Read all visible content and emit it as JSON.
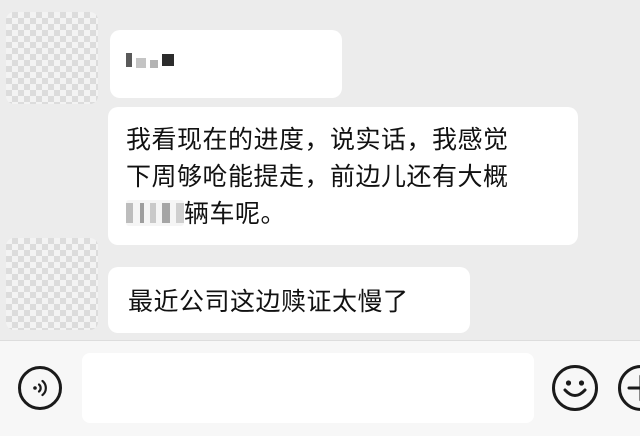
{
  "messages": [
    {
      "sender": "contact",
      "type": "name-redacted"
    },
    {
      "sender": "contact",
      "line1": "我看现在的进度，说实话，我感觉",
      "line2": "下周够呛能提走，前边儿还有大概",
      "line3_suffix": "辆车呢。"
    },
    {
      "sender": "contact",
      "text": "最近公司这边赎证太慢了"
    }
  ],
  "input_bar": {
    "value": "",
    "placeholder": "",
    "voice_icon": "voice-icon",
    "emoji_icon": "emoji-icon",
    "more_icon": "plus-icon"
  },
  "colors": {
    "chat_background": "#ececec",
    "bubble": "#ffffff",
    "bar_background": "#f7f7f7",
    "text": "#111111"
  }
}
